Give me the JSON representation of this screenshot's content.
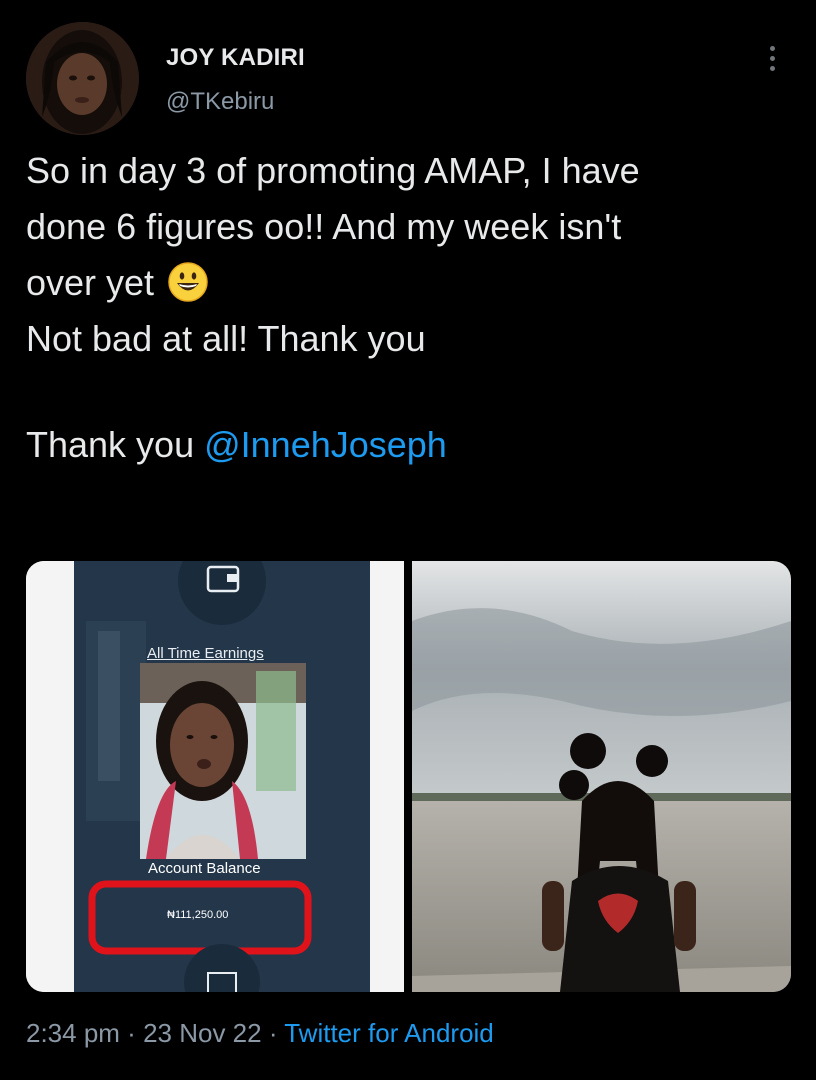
{
  "author": {
    "display_name": "JOY KADIRI",
    "handle": "@TKebiru",
    "avatar_icon": "profile-photo"
  },
  "tweet": {
    "lines": [
      "So in day 3 of promoting AMAP, I have",
      "done 6 figures oo!! And my week isn't",
      "over yet",
      "Not bad at all! Thank you"
    ],
    "thanks_prefix": "Thank you ",
    "mention": "@InnehJoseph",
    "emoji": "grinning-face-emoji"
  },
  "media": {
    "screenshot": {
      "earnings_label": "All Time Earnings",
      "balance_label": "Account Balance",
      "balance_amount": "₦111,250.00",
      "highlight_color": "#e0131a"
    },
    "photo": {
      "subject": "photo-outdoor-portrait"
    }
  },
  "footer": {
    "time": "2:34 pm",
    "separator": " · ",
    "date": "23 Nov 22",
    "source": "Twitter for Android"
  },
  "colors": {
    "background": "#000000",
    "text": "#e7e9ea",
    "muted": "#8b98a5",
    "link": "#1d9bf0"
  }
}
